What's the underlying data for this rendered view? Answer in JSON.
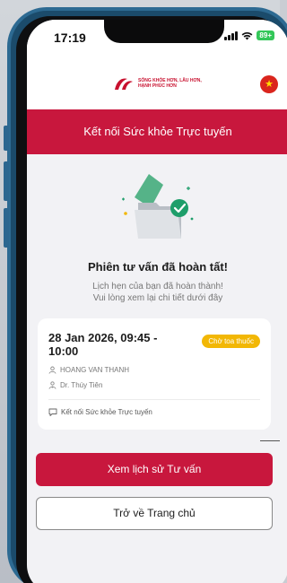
{
  "status_bar": {
    "time": "17:19",
    "battery": "89+"
  },
  "header": {
    "logo_line1": "SỐNG KHỎE HƠN, LÂU HƠN,",
    "logo_line2": "HẠNH PHÚC HƠN",
    "logo_brand": "AIA",
    "flag_icon": "vietnam-flag-icon"
  },
  "banner": {
    "title": "Kết nối Sức khỏe Trực tuyến"
  },
  "completion": {
    "title": "Phiên tư vấn đã hoàn tất!",
    "description_line1": "Lịch hẹn của bạn đã hoàn thành!",
    "description_line2": "Vui lòng xem lại chi tiết dưới đây"
  },
  "appointment": {
    "datetime_line1": "28 Jan 2026, 09:45 -",
    "datetime_line2": "10:00",
    "badge": "Chờ toa thuốc",
    "patient": "HOANG VAN THANH",
    "doctor": "Dr. Thúy Tiên",
    "service": "Kết nối Sức khỏe Trực tuyến"
  },
  "actions": {
    "primary_label": "Xem lịch sử Tư vấn",
    "secondary_label": "Trở về Trang chủ"
  },
  "colors": {
    "brand": "#c8173d",
    "badge": "#f2b705",
    "success": "#1e9e6a"
  }
}
